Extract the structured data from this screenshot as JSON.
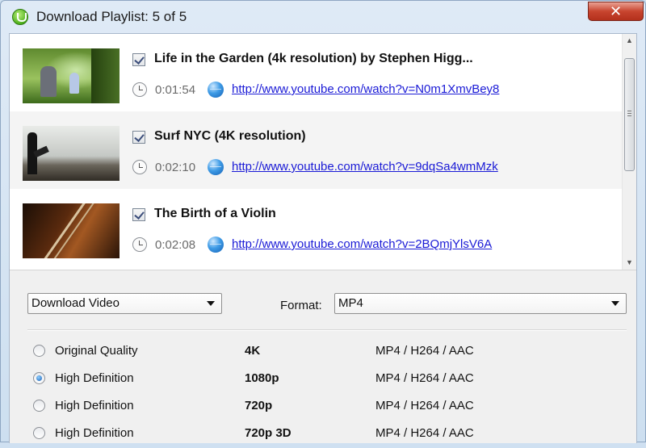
{
  "window": {
    "title": "Download Playlist: 5 of 5",
    "close_label": "✕"
  },
  "playlist": {
    "items": [
      {
        "title": "Life in the Garden (4k resolution) by Stephen Higg...",
        "duration": "0:01:54",
        "url": "http://www.youtube.com/watch?v=N0m1XmvBey8",
        "checked": true
      },
      {
        "title": "Surf NYC (4K resolution)",
        "duration": "0:02:10",
        "url": "http://www.youtube.com/watch?v=9dqSa4wmMzk",
        "checked": true
      },
      {
        "title": "The Birth of a Violin",
        "duration": "0:02:08",
        "url": "http://www.youtube.com/watch?v=2BQmjYlsV6A",
        "checked": true
      }
    ]
  },
  "options": {
    "action_value": "Download Video",
    "format_label": "Format:",
    "format_value": "MP4"
  },
  "qualities": [
    {
      "label": "Original Quality",
      "resolution": "4K",
      "format": "MP4 / H264 / AAC",
      "selected": false
    },
    {
      "label": "High Definition",
      "resolution": "1080p",
      "format": "MP4 / H264 / AAC",
      "selected": true
    },
    {
      "label": "High Definition",
      "resolution": "720p",
      "format": "MP4 / H264 / AAC",
      "selected": false
    },
    {
      "label": "High Definition",
      "resolution": "720p 3D",
      "format": "MP4 / H264 / AAC",
      "selected": false
    }
  ],
  "colors": {
    "link": "#1a1ad6",
    "close_button": "#c8452f",
    "window_frame": "#dfeaf6"
  },
  "icons": {
    "app": "downloader-app-icon",
    "duration": "clock-icon",
    "url": "globe-icon"
  }
}
